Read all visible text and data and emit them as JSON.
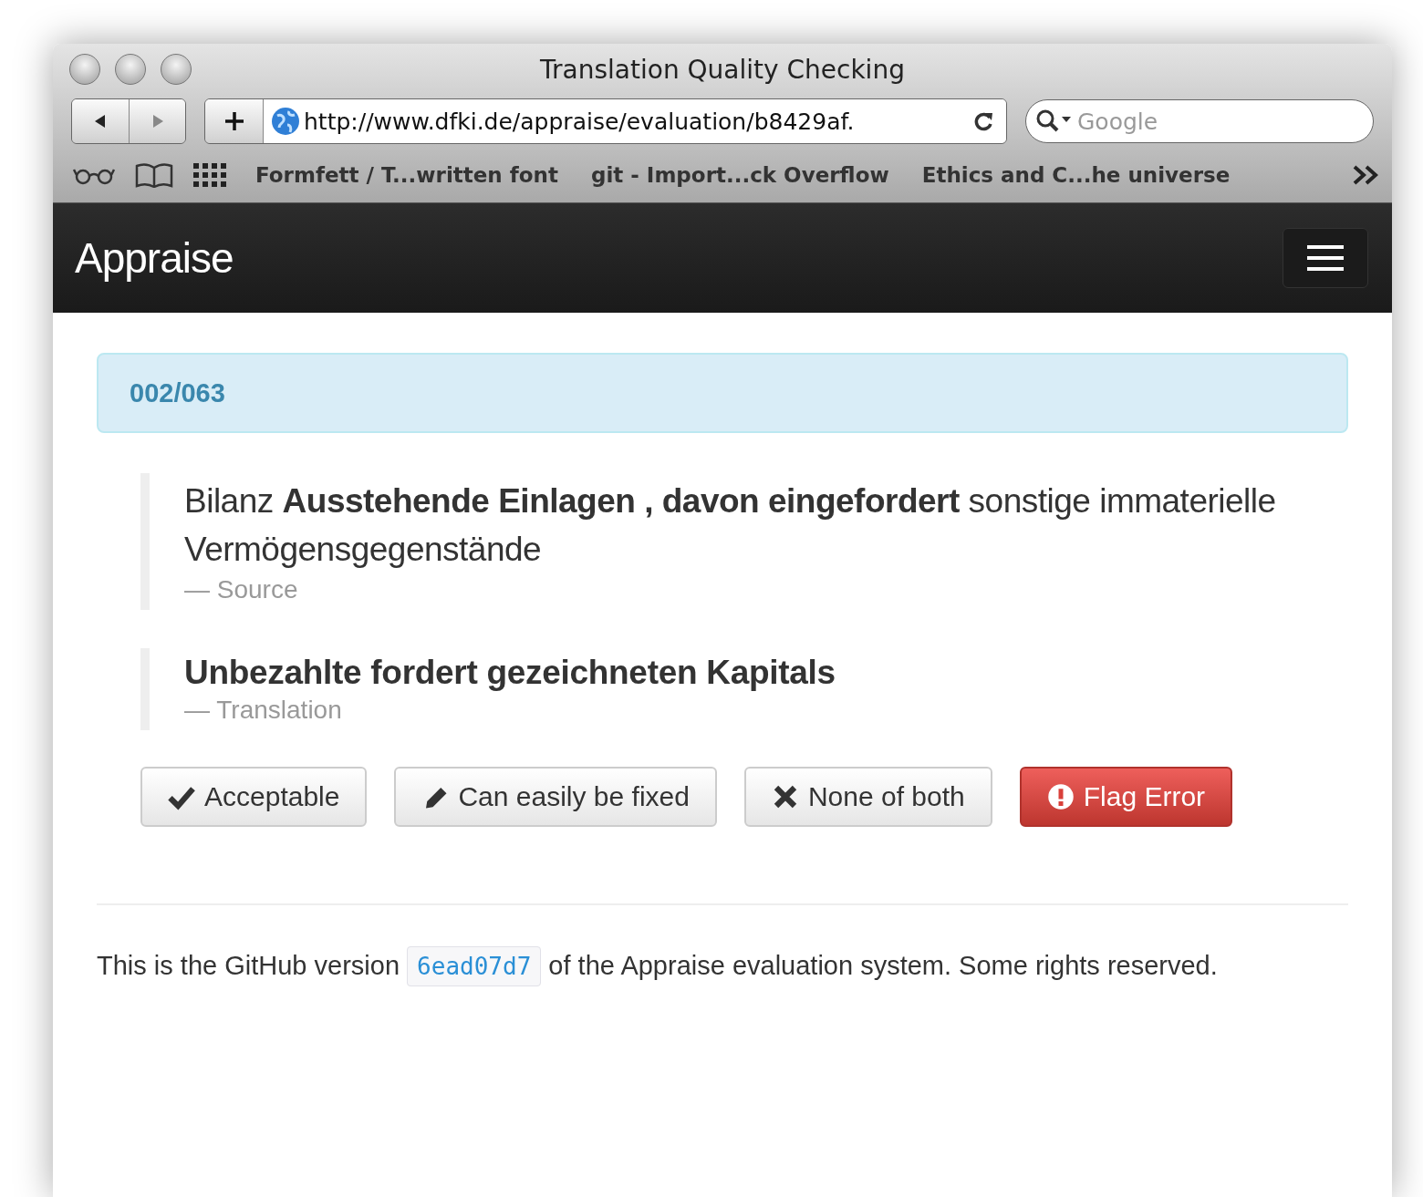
{
  "window": {
    "title": "Translation Quality Checking"
  },
  "toolbar": {
    "url": "http://www.dfki.de/appraise/evaluation/b8429af.",
    "search": {
      "placeholder": "Google"
    }
  },
  "bookmarks": [
    {
      "label": "Formfett / T...written font"
    },
    {
      "label": "git - Import...ck Overflow"
    },
    {
      "label": "Ethics and C...he universe"
    }
  ],
  "navbar": {
    "brand": "Appraise"
  },
  "progress": "002/063",
  "quotes": [
    {
      "kind": "source",
      "text": "Bilanz **Ausstehende Einlagen , davon eingefordert** sonstige immaterielle Vermögensgegenstände",
      "caption": "— Source"
    },
    {
      "kind": "translation",
      "text": "Unbezahlte fordert gezeichneten Kapitals",
      "caption": "— Translation"
    }
  ],
  "buttons": [
    {
      "label": "Acceptable",
      "kind": "accept"
    },
    {
      "label": "Can easily be fixed",
      "kind": "fix"
    },
    {
      "label": "None of both",
      "kind": "reject"
    },
    {
      "label": "Flag Error",
      "kind": "flag"
    }
  ],
  "footer": {
    "before": "This is the GitHub version",
    "code": "6ead07d7",
    "after": "of the Appraise evaluation system. Some rights reserved."
  }
}
